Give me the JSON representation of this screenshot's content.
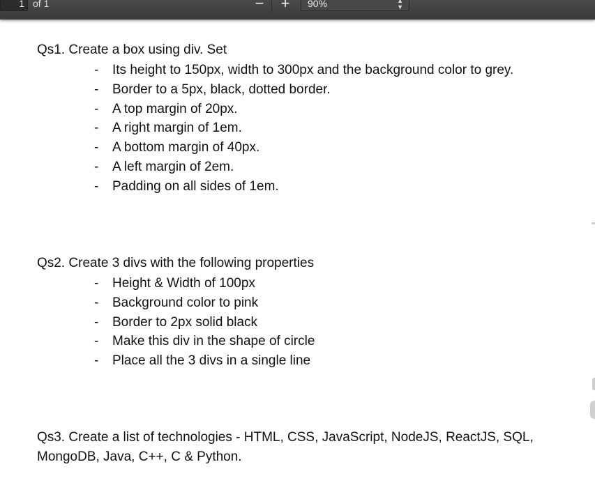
{
  "toolbar": {
    "page_number": "1",
    "page_of": "of 1",
    "zoom_out_label": "−",
    "zoom_in_label": "+",
    "zoom_value": "90%"
  },
  "document": {
    "q1": {
      "title": "Qs1. Create a box using div. Set",
      "bullets": [
        "Its height to 150px, width to 300px and the background color to grey.",
        "Border to a 5px, black, dotted border.",
        "A top margin of 20px.",
        "A right margin of 1em.",
        "A bottom margin of 40px.",
        "A left margin of 2em.",
        "Padding on all sides of 1em."
      ]
    },
    "q2": {
      "title": "Qs2. Create 3 divs with the following properties",
      "bullets": [
        "Height & Width of 100px",
        "Background color to pink",
        "Border to 2px solid black",
        "Make this div in the shape of circle",
        "Place all the 3 divs in a single line"
      ]
    },
    "q3": {
      "line1": "Qs3. Create a list of technologies - HTML, CSS, JavaScript, NodeJS, ReactJS, SQL,",
      "line2": "MongoDB, Java, C++, C & Python."
    },
    "bullet_char": "-"
  }
}
